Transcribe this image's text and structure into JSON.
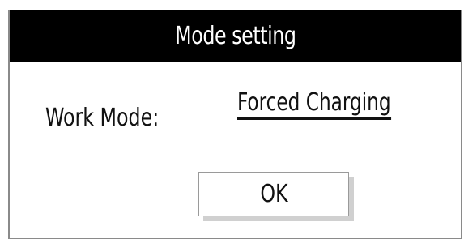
{
  "dialog": {
    "title": "Mode setting",
    "work_mode_label": "Work Mode:",
    "work_mode_value": "Forced Charging",
    "ok_label": "OK"
  },
  "colors": {
    "titlebar_background": "#000000",
    "title_text": "#ffffff",
    "body_text": "#111111",
    "button_shadow": "#d0d0d0"
  }
}
